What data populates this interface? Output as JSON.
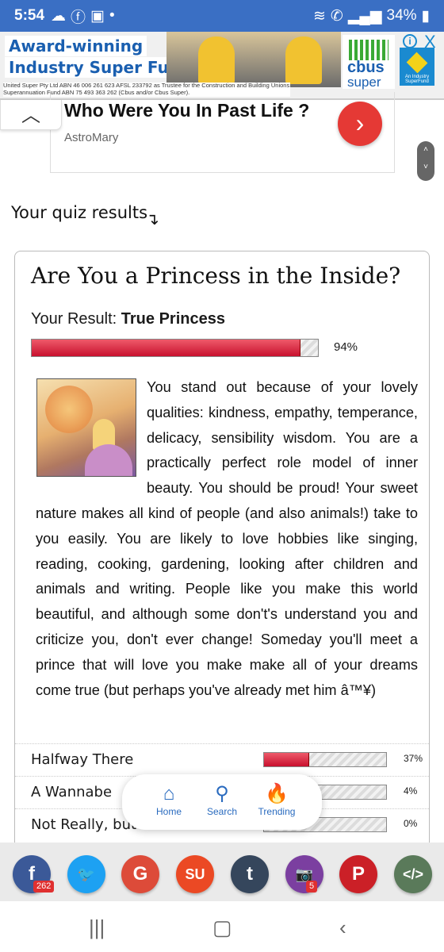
{
  "status": {
    "time": "5:54",
    "battery": "34%"
  },
  "ad": {
    "line1": "Award-winning",
    "line2": "Industry Super Fund",
    "logo_top": "cbus",
    "logo_bottom": "super",
    "badge": "An Industry SuperFund",
    "info_label": "i",
    "close_label": "X",
    "fineprint": "United Super Pty Ltd ABN 46 006 261 623 AFSL 233792 as Trustee for the Construction and Building Unions Superannuation Fund ABN 75 493 363 262 (Cbus and/or Cbus Super)."
  },
  "promo": {
    "title": "Who Were You In Past Life ?",
    "source": "AstroMary"
  },
  "quiz": {
    "section_title": "Your quiz results",
    "title": "Are You a Princess in the Inside?",
    "result_prefix": "Your Result: ",
    "result": "True Princess",
    "percent_label": "94%",
    "percent_value": 0.94,
    "description": "You stand out because of your lovely qualities: kindness, empathy, temperance, delicacy, sensibility wisdom. You are a practically perfect role model of inner beauty. You should be proud! Your sweet nature makes all kind of people (and also animals!) take to you easily. You are likely to love hobbies like singing, reading, cooking, gardening, looking after children and animals and writing. People like you make this world beautiful, and although some don't's understand you and criticize you, don't ever change! Someday you'll meet a prince that will love you make make all of your dreams come true (but perhaps you've already met him â™¥)",
    "other_results": [
      {
        "label": "Halfway There",
        "percent_label": "37%",
        "value": 0.37
      },
      {
        "label": "A Wannabe",
        "percent_label": "4%",
        "value": 0.04
      },
      {
        "label": "Not Really, but c",
        "percent_label": "0%",
        "value": 0.0
      }
    ]
  },
  "bottom_nav": [
    {
      "label": "Home",
      "icon": "home-icon"
    },
    {
      "label": "Search",
      "icon": "search-icon"
    },
    {
      "label": "Trending",
      "icon": "fire-icon"
    }
  ],
  "share": [
    {
      "name": "facebook",
      "glyph": "f",
      "color": "#3b5998",
      "count": "262"
    },
    {
      "name": "twitter",
      "glyph": "🐦",
      "color": "#1da1f2",
      "count": ""
    },
    {
      "name": "google",
      "glyph": "G",
      "color": "#dd4b39",
      "count": ""
    },
    {
      "name": "stumbleupon",
      "glyph": "SU",
      "color": "#eb4924",
      "count": ""
    },
    {
      "name": "tumblr",
      "glyph": "t",
      "color": "#35465c",
      "count": ""
    },
    {
      "name": "camera",
      "glyph": "📷",
      "color": "#7b3fa0",
      "count": "5"
    },
    {
      "name": "pinterest",
      "glyph": "P",
      "color": "#cb2027",
      "count": ""
    },
    {
      "name": "embed",
      "glyph": "</>",
      "color": "#5a7a5a",
      "count": ""
    }
  ]
}
